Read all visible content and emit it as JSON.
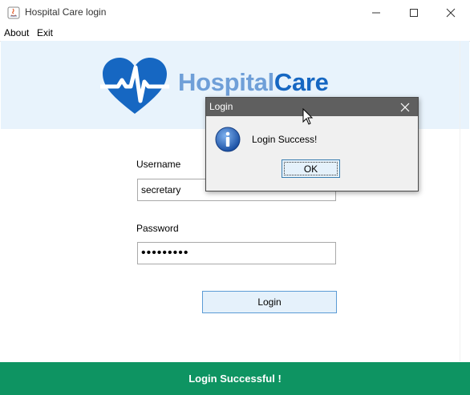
{
  "window": {
    "title": "Hospital Care login"
  },
  "menu": {
    "items": [
      "About",
      "Exit"
    ]
  },
  "logo": {
    "word1": "Hospital",
    "word2": "Care"
  },
  "form": {
    "username_label": "Username",
    "username_value": "secretary",
    "password_label": "Password",
    "password_masked": "•••••••••",
    "login_label": "Login"
  },
  "status": {
    "text": "Login Successful !"
  },
  "dialog": {
    "title": "Login",
    "message": "Login Success!",
    "ok_label": "OK"
  },
  "colors": {
    "banner_bg": "#e8f3fc",
    "logo_heart": "#1667c2",
    "status_bar": "#0e9462",
    "dialog_title": "#5f5f5f"
  },
  "icons": [
    "java-app-icon",
    "minimize-icon",
    "maximize-icon",
    "close-icon",
    "heart-pulse-logo-icon",
    "information-icon",
    "mouse-cursor-icon"
  ]
}
